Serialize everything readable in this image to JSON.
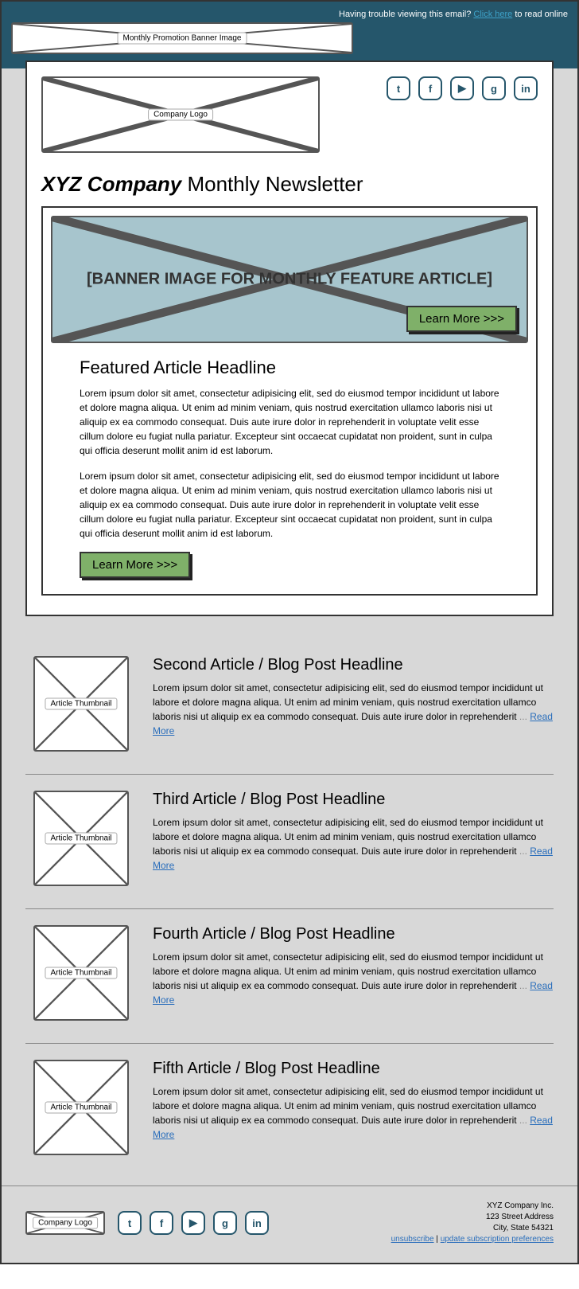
{
  "top": {
    "trouble_text": "Having trouble viewing this email?",
    "click_here": "Click here",
    "read_online": " to read online",
    "promo_label": "Monthly Promotion Banner Image"
  },
  "header": {
    "logo_label": "Company Logo",
    "social": [
      "t",
      "f",
      "▶",
      "g",
      "in"
    ]
  },
  "title": {
    "company": "XYZ Company",
    "suffix": " Monthly Newsletter"
  },
  "feature": {
    "banner_text": "[BANNER IMAGE FOR MONTHLY FEATURE ARTICLE]",
    "learn_more": "Learn More >>>",
    "headline": "Featured Article Headline",
    "p1": "Lorem ipsum dolor sit amet, consectetur adipisicing elit, sed do eiusmod tempor incididunt ut labore et dolore magna aliqua. Ut enim ad minim veniam, quis nostrud exercitation ullamco laboris nisi ut aliquip ex ea commodo consequat. Duis aute irure dolor in reprehenderit in voluptate velit esse cillum dolore eu fugiat nulla pariatur. Excepteur sint occaecat cupidatat non proident, sunt in culpa qui officia deserunt mollit anim id est laborum.",
    "p2": "Lorem ipsum dolor sit amet, consectetur adipisicing elit, sed do eiusmod tempor incididunt ut labore et dolore magna aliqua. Ut enim ad minim veniam, quis nostrud exercitation ullamco laboris nisi ut aliquip ex ea commodo consequat. Duis aute irure dolor in reprehenderit in voluptate velit esse cillum dolore eu fugiat nulla pariatur. Excepteur sint occaecat cupidatat non proident, sunt in culpa qui officia deserunt mollit anim id est laborum."
  },
  "articles": [
    {
      "thumb_label": "Article Thumbnail",
      "headline": "Second Article / Blog Post Headline",
      "excerpt": "Lorem ipsum dolor sit amet, consectetur adipisicing elit, sed do eiusmod tempor incididunt ut labore et dolore magna aliqua. Ut enim ad minim veniam, quis nostrud exercitation ullamco laboris nisi ut aliquip ex ea commodo consequat. Duis aute irure dolor in reprehenderit ",
      "read_more": "Read More"
    },
    {
      "thumb_label": "Article Thumbnail",
      "headline": "Third Article / Blog Post Headline",
      "excerpt": "Lorem ipsum dolor sit amet, consectetur adipisicing elit, sed do eiusmod tempor incididunt ut labore et dolore magna aliqua. Ut enim ad minim veniam, quis nostrud exercitation ullamco laboris nisi ut aliquip ex ea commodo consequat. Duis aute irure dolor in reprehenderit ",
      "read_more": "Read More"
    },
    {
      "thumb_label": "Article Thumbnail",
      "headline": "Fourth Article / Blog Post Headline",
      "excerpt": "Lorem ipsum dolor sit amet, consectetur adipisicing elit, sed do eiusmod tempor incididunt ut labore et dolore magna aliqua. Ut enim ad minim veniam, quis nostrud exercitation ullamco laboris nisi ut aliquip ex ea commodo consequat. Duis aute irure dolor in reprehenderit ",
      "read_more": "Read More"
    },
    {
      "thumb_label": "Article Thumbnail",
      "headline": "Fifth Article / Blog Post Headline",
      "excerpt": "Lorem ipsum dolor sit amet, consectetur adipisicing elit, sed do eiusmod tempor incididunt ut labore et dolore magna aliqua. Ut enim ad minim veniam, quis nostrud exercitation ullamco laboris nisi ut aliquip ex ea commodo consequat. Duis aute irure dolor in reprehenderit ",
      "read_more": "Read More"
    }
  ],
  "footer": {
    "logo_label": "Company Logo",
    "social": [
      "t",
      "f",
      "▶",
      "g",
      "in"
    ],
    "company": "XYZ Company Inc.",
    "address1": "123 Street Address",
    "address2": "City, State 54321",
    "unsubscribe": "unsubscribe",
    "sep": " | ",
    "update": "update subscription preferences"
  }
}
